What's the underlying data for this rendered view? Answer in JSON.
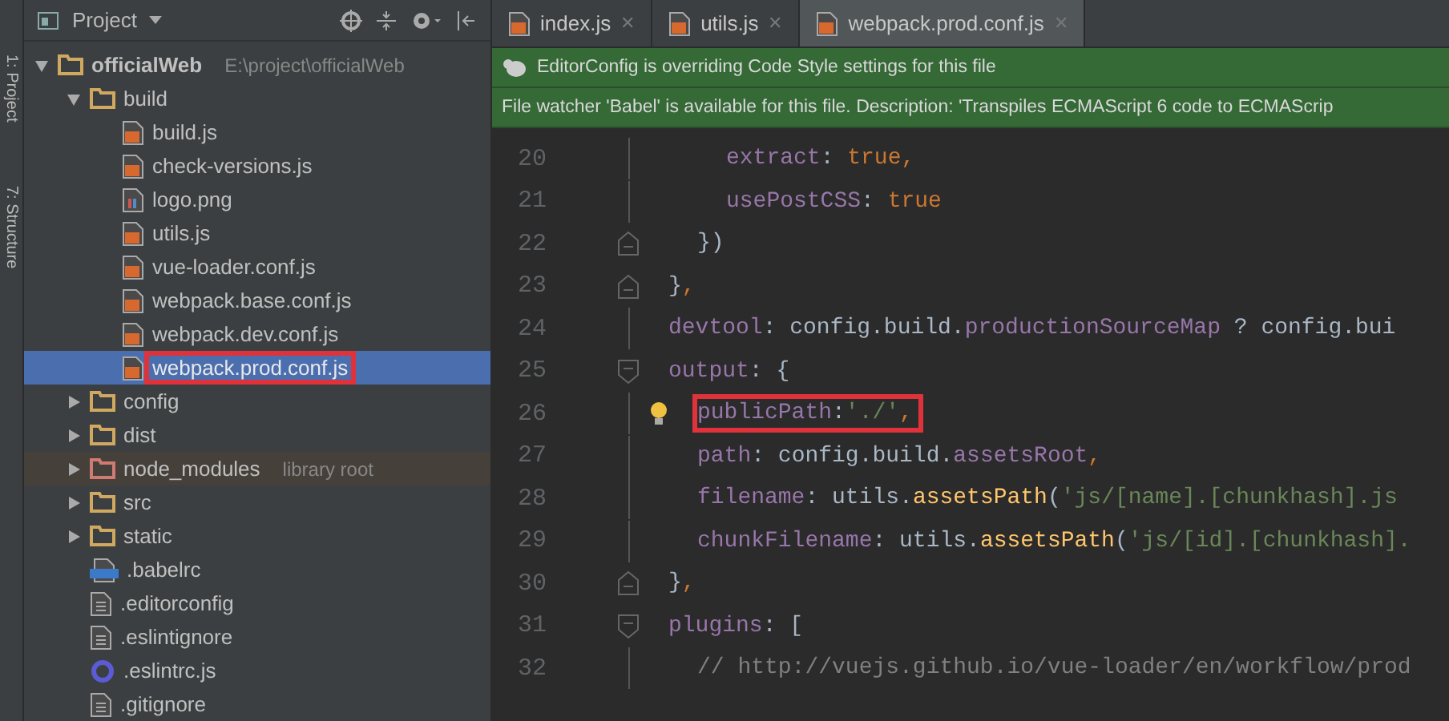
{
  "tool_stripe": [
    "1: Project",
    "7: Structure"
  ],
  "project_panel": {
    "title": "Project",
    "tree": [
      {
        "label": "officialWeb",
        "hint": "E:\\project\\officialWeb",
        "kind": "folder",
        "expanded": true,
        "selected": false,
        "children": [
          {
            "label": "build",
            "kind": "folder",
            "expanded": true,
            "selected": false,
            "children": [
              {
                "label": "build.js",
                "kind": "js",
                "selected": false
              },
              {
                "label": "check-versions.js",
                "kind": "js",
                "selected": false
              },
              {
                "label": "logo.png",
                "kind": "image",
                "selected": false
              },
              {
                "label": "utils.js",
                "kind": "js",
                "selected": false
              },
              {
                "label": "vue-loader.conf.js",
                "kind": "js",
                "selected": false
              },
              {
                "label": "webpack.base.conf.js",
                "kind": "js",
                "selected": false
              },
              {
                "label": "webpack.dev.conf.js",
                "kind": "js",
                "selected": false
              },
              {
                "label": "webpack.prod.conf.js",
                "kind": "js",
                "selected": true,
                "annotated": true
              }
            ]
          },
          {
            "label": "config",
            "kind": "folder",
            "expanded": false,
            "selected": false
          },
          {
            "label": "dist",
            "kind": "folder",
            "expanded": false,
            "selected": false
          },
          {
            "label": "node_modules",
            "hint": "library root",
            "kind": "excluded",
            "expanded": false,
            "selected": false
          },
          {
            "label": "src",
            "kind": "folder",
            "expanded": false,
            "selected": false
          },
          {
            "label": "static",
            "kind": "folder",
            "expanded": false,
            "selected": false
          },
          {
            "label": ".babelrc",
            "kind": "json",
            "selected": false
          },
          {
            "label": ".editorconfig",
            "kind": "text",
            "selected": false
          },
          {
            "label": ".eslintignore",
            "kind": "text",
            "selected": false
          },
          {
            "label": ".eslintrc.js",
            "kind": "eslint",
            "selected": false
          },
          {
            "label": ".gitignore",
            "kind": "text",
            "selected": false
          }
        ]
      }
    ]
  },
  "editor": {
    "tabs": [
      {
        "label": "index.js",
        "close": "✕",
        "selected": false
      },
      {
        "label": "utils.js",
        "close": "✕",
        "selected": false
      },
      {
        "label": "webpack.prod.conf.js",
        "close": "✕",
        "selected": true
      }
    ],
    "banners": [
      {
        "text": "EditorConfig is overriding Code Style settings for this file",
        "icon": true
      },
      {
        "text": "File watcher 'Babel' is available for this file. Description: 'Transpiles ECMAScript 6 code to ECMAScrip"
      }
    ],
    "lines": [
      {
        "children": [
          {
            "children": [
              {
                "number": "20",
                "kind": "plain",
                "tokens": [
                  {
                    "kind": "key",
                    "text": "extract"
                  },
                  {
                    "kind": "punct",
                    "text": ": "
                  },
                  {
                    "kind": "keyword",
                    "text": "true"
                  },
                  {
                    "kind": "keyword",
                    "text": ","
                  }
                ]
              },
              {
                "number": "21",
                "kind": "plain",
                "tokens": [
                  {
                    "kind": "key",
                    "text": "usePostCSS"
                  },
                  {
                    "kind": "punct",
                    "text": ": "
                  },
                  {
                    "kind": "keyword",
                    "text": "true"
                  }
                ]
              }
            ]
          },
          {
            "number": "22",
            "kind": "fold-end",
            "tokens": [
              {
                "kind": "punct",
                "text": "})"
              }
            ]
          }
        ]
      },
      {
        "number": "23",
        "kind": "fold-end",
        "tokens": [
          {
            "kind": "punct",
            "text": "}"
          },
          {
            "kind": "keyword",
            "text": ","
          }
        ]
      },
      {
        "number": "24",
        "kind": "plain",
        "tokens": [
          {
            "kind": "key",
            "text": "devtool"
          },
          {
            "kind": "punct",
            "text": ": config.build."
          },
          {
            "kind": "key",
            "text": "productionSourceMap"
          },
          {
            "kind": "punct",
            "text": " ? config.bui"
          }
        ]
      },
      {
        "number": "25",
        "kind": "fold-start",
        "tokens": [
          {
            "kind": "key",
            "text": "output"
          },
          {
            "kind": "punct",
            "text": ": {"
          }
        ],
        "children": [
          {
            "number": "26",
            "kind": "plain",
            "annotated": true,
            "bulb": true,
            "tokens": [
              {
                "kind": "key",
                "text": "publicPath"
              },
              {
                "kind": "punct",
                "text": ":"
              },
              {
                "kind": "string",
                "text": "'./'"
              },
              {
                "kind": "keyword",
                "text": ","
              }
            ]
          },
          {
            "number": "27",
            "kind": "plain",
            "tokens": [
              {
                "kind": "key",
                "text": "path"
              },
              {
                "kind": "punct",
                "text": ": config.build."
              },
              {
                "kind": "key",
                "text": "assetsRoot"
              },
              {
                "kind": "keyword",
                "text": ","
              }
            ]
          },
          {
            "number": "28",
            "kind": "plain",
            "tokens": [
              {
                "kind": "key",
                "text": "filename"
              },
              {
                "kind": "punct",
                "text": ": utils."
              },
              {
                "kind": "fn",
                "text": "assetsPath"
              },
              {
                "kind": "punct",
                "text": "("
              },
              {
                "kind": "string",
                "text": "'js/[name].[chunkhash].js"
              }
            ]
          },
          {
            "number": "29",
            "kind": "plain",
            "tokens": [
              {
                "kind": "key",
                "text": "chunkFilename"
              },
              {
                "kind": "punct",
                "text": ": utils."
              },
              {
                "kind": "fn",
                "text": "assetsPath"
              },
              {
                "kind": "punct",
                "text": "("
              },
              {
                "kind": "string",
                "text": "'js/[id].[chunkhash]."
              }
            ]
          }
        ]
      },
      {
        "number": "30",
        "kind": "fold-end",
        "tokens": [
          {
            "kind": "punct",
            "text": "}"
          },
          {
            "kind": "keyword",
            "text": ","
          }
        ]
      },
      {
        "number": "31",
        "kind": "fold-start",
        "tokens": [
          {
            "kind": "key",
            "text": "plugins"
          },
          {
            "kind": "punct",
            "text": ": ["
          }
        ],
        "children": [
          {
            "number": "32",
            "kind": "plain",
            "tokens": [
              {
                "kind": "comment",
                "text": "// http://vuejs.github.io/vue-loader/en/workflow/prod"
              }
            ]
          }
        ]
      }
    ]
  }
}
